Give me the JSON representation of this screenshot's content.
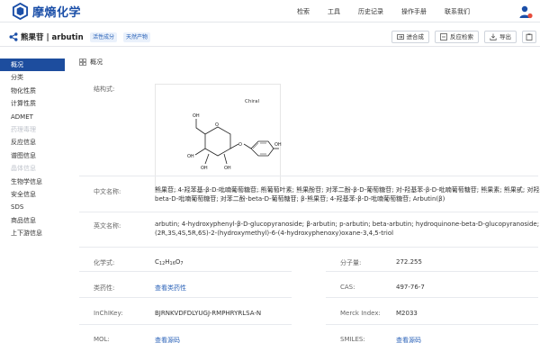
{
  "brand": {
    "name": "摩熵化学"
  },
  "nav": {
    "items": [
      "检索",
      "工具",
      "历史记录",
      "操作手册",
      "联系我们"
    ]
  },
  "compound": {
    "title": "熊果苷 | arbutin",
    "tags": [
      "活性成分",
      "天然产物"
    ],
    "actions": [
      "进合成",
      "反应检索",
      "导出"
    ]
  },
  "sidebar": {
    "items": [
      {
        "label": "概况",
        "state": "active"
      },
      {
        "label": "分类",
        "state": "normal"
      },
      {
        "label": "物化性质",
        "state": "normal"
      },
      {
        "label": "计算性质",
        "state": "normal"
      },
      {
        "label": "ADMET",
        "state": "normal"
      },
      {
        "label": "药理毒理",
        "state": "disabled"
      },
      {
        "label": "反应信息",
        "state": "normal"
      },
      {
        "label": "谱图信息",
        "state": "normal"
      },
      {
        "label": "晶体信息",
        "state": "disabled"
      },
      {
        "label": "生物学信息",
        "state": "normal"
      },
      {
        "label": "安全信息",
        "state": "normal"
      },
      {
        "label": "SDS",
        "state": "normal"
      },
      {
        "label": "商品信息",
        "state": "normal"
      },
      {
        "label": "上下游信息",
        "state": "normal"
      }
    ]
  },
  "overview": {
    "section_title": "概况",
    "structure_label": "结构式:",
    "chiral_label": "Chiral",
    "atom_labels": {
      "oxygen": "O",
      "hydroxyl": "OH"
    },
    "chinese_name_label": "中文名称:",
    "chinese_name_line1": "熊果苷; 4-羟苯基-β-D-吡喃葡萄糖苷; 熊葡萄叶素; 熊果酚苷; 对苯二酚-β-D-葡萄糖苷; 对-羟基苯-β-D-吡喃葡萄糖苷; 熊果素; 熊果甙; 对羟基苯-",
    "chinese_name_line2": "beta-D-吡喃葡萄糖苷; 对苯二酚-beta-D-葡萄糖苷; β-熊果苷; 4-羟基苯-β-D-吡喃葡萄糖苷; Arbutin(β)",
    "english_name_label": "英文名称:",
    "english_name_line1": "arbutin; 4-hydroxyphenyl-β-D-glucopyranoside; β-arbutin; p-arbutin; beta-arbutin; hydroquinone-beta-D-glucopyranoside;",
    "english_name_line2": "(2R,3S,4S,5R,6S)-2-(hydroxymethyl)-6-(4-hydroxyphenoxy)oxane-3,4,5-triol",
    "formula_label": "化学式:",
    "formula": {
      "c": "C",
      "c_n": "12",
      "h": "H",
      "h_n": "16",
      "o": "O",
      "o_n": "7"
    },
    "mw_label": "分子量:",
    "mw_value": "272.255",
    "related_label": "类药性:",
    "related_value": "查看类药性",
    "cas_label": "CAS:",
    "cas_value": "497-76-7",
    "inchikey_label": "InChIKey:",
    "inchikey_value": "BJRNKVDFDLYUGJ-RMPHRYRLSA-N",
    "merck_label": "Merck Index:",
    "merck_value": "M2033",
    "mol_label": "MOL:",
    "mol_value": "查看源码",
    "smiles_label": "SMILES:",
    "smiles_value": "查看源码"
  },
  "colors": {
    "brand": "#1b4fa8",
    "active": "#1d4d9e",
    "link": "#2a62b8"
  }
}
